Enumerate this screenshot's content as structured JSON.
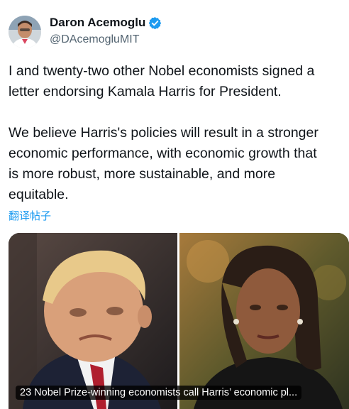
{
  "author": {
    "display_name": "Daron Acemoglu",
    "handle": "@DAcemogluMIT",
    "verified_icon": "verified-badge-icon",
    "verified_color": "#1d9bf0"
  },
  "tweet": {
    "paragraph1": [
      "I and twenty-two other Nobel economists signed a",
      "letter endorsing Kamala Harris for President."
    ],
    "paragraph2": [
      "We believe Harris's policies will result in a stronger",
      "economic performance, with economic growth that",
      "is more robust, more sustainable, and more",
      "equitable."
    ],
    "translate_label": "翻译帖子"
  },
  "media": {
    "link_caption": "23 Nobel Prize-winning economists call Harris’ economic pl..."
  },
  "colors": {
    "text": "#0f1419",
    "secondary": "#536471",
    "link": "#1d9bf0"
  }
}
